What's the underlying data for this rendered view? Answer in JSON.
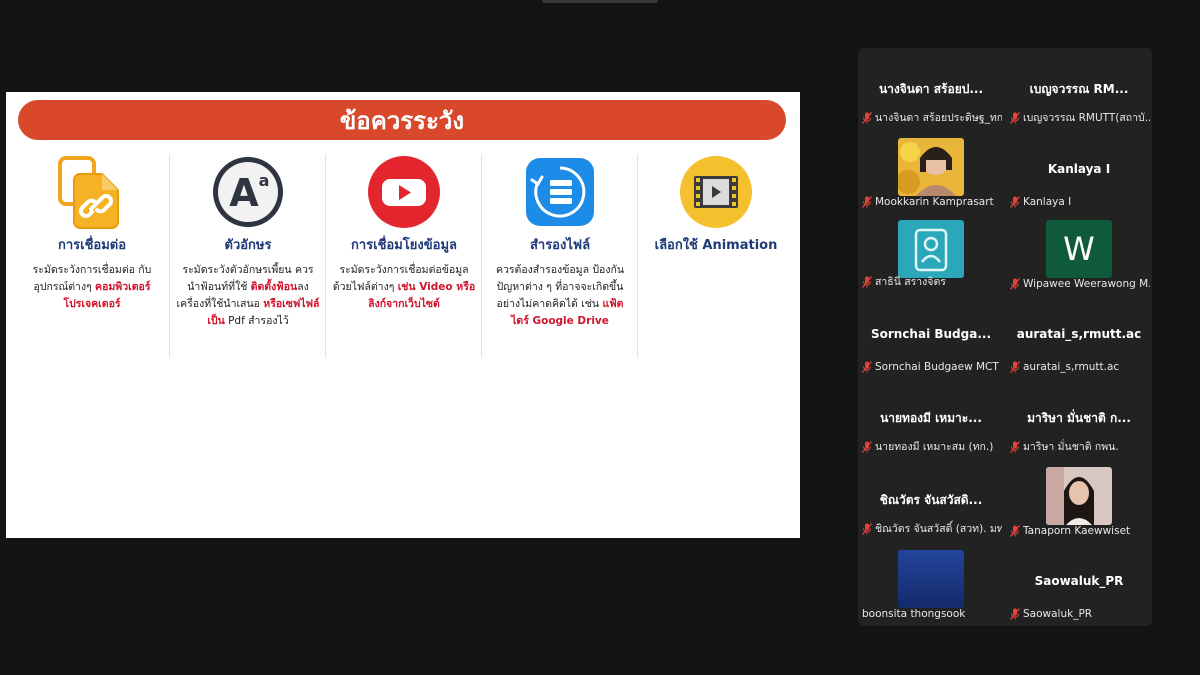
{
  "slide": {
    "title": "ข้อควรระวัง",
    "columns": [
      {
        "title": "การเชื่อมต่อ",
        "icon": "link-copy-icon",
        "body_before": "ระมัดระวังการเชื่อมต่อ กับอุปกรณ์ต่างๆ ",
        "body_highlight": "คอมพิวเตอร์ โปรเจคเตอร์",
        "body_after": ""
      },
      {
        "title": "ตัวอักษร",
        "icon": "font-icon",
        "body_before": "ระมัดระวังตัวอักษรเพี้ยน ควรนำฟ้อนท์ที่ใช้ ",
        "body_highlight": "ติดตั้งฟ้อน",
        "body_mid": "ลงเครื่องที่ใช้นำเสนอ ",
        "body_highlight2": "หรือเซฟไฟล์เป็น",
        "body_after": " Pdf สำรองไว้"
      },
      {
        "title": "การเชื่อมโยงข้อมูล",
        "icon": "youtube-icon",
        "body_before": "ระมัดระวังการเชื่อมต่อข้อมูล ด้วยไฟล์ต่างๆ ",
        "body_highlight": "เช่น Video หรือลิงก์จากเว็บไซต์",
        "body_after": ""
      },
      {
        "title": "สำรองไฟล์",
        "icon": "backup-icon",
        "body_before": "ควรต้องสำรองข้อมูล ป้องกันปัญหาต่าง ๆ ที่อาจจะเกิดขึ้นอย่างไม่คาดคิดได้ เช่น ",
        "body_highlight": "แฟ้ตไดร์ Google Drive",
        "body_after": ""
      },
      {
        "title": "เลือกใช้ Animation",
        "icon": "film-icon",
        "body_before": "",
        "body_highlight": "",
        "body_after": ""
      }
    ]
  },
  "participants": [
    {
      "name": "นางจินดา สร้อยป...",
      "label": "นางจินดา สร้อยประดิษฐ_ทก.",
      "avatar": null
    },
    {
      "name": "เบญจวรรณ RM...",
      "label": "เบญจวรรณ RMUTT(สถาบั...",
      "avatar": null
    },
    {
      "name": "",
      "label": "Mookkarin Kamprasart",
      "avatar": "photo-yellow"
    },
    {
      "name": "Kanlaya I",
      "label": "Kanlaya I",
      "avatar": null
    },
    {
      "name": "",
      "label": "สาธินี สรางจิตร",
      "avatar": "person-placeholder"
    },
    {
      "name": "",
      "label": "Wipawee Weerawong M...",
      "avatar": "letter-w",
      "avatar_letter": "W"
    },
    {
      "name": "Sornchai Budga...",
      "label": "Sornchai Budgaew MCT",
      "avatar": null
    },
    {
      "name": "auratai_s,rmutt.ac",
      "label": "auratai_s,rmutt.ac",
      "avatar": null
    },
    {
      "name": "นายทองมี เหมาะ...",
      "label": "นายทองมี เหมาะสม (ทก.)",
      "avatar": null
    },
    {
      "name": "มาริษา มั่นชาติ ก...",
      "label": "มาริษา มั่นชาติ กพน.",
      "avatar": null
    },
    {
      "name": "ชิณวัตร จันสวัสดิ...",
      "label": "ชิณวัตร จันสวัสดิ์ (สวท). มท...",
      "avatar": null
    },
    {
      "name": "",
      "label": "Tanaporn Kaewwiset",
      "avatar": "photo-woman"
    },
    {
      "name": "",
      "label": "boonsita thongsook",
      "avatar": "blue-square"
    },
    {
      "name": "Saowaluk_PR",
      "label": "Saowaluk_PR",
      "avatar": null
    }
  ],
  "colors": {
    "banner": "#d9482b",
    "highlight": "#d0142c",
    "title_blue": "#1f3a78",
    "muted_mic": "#e0453a"
  }
}
